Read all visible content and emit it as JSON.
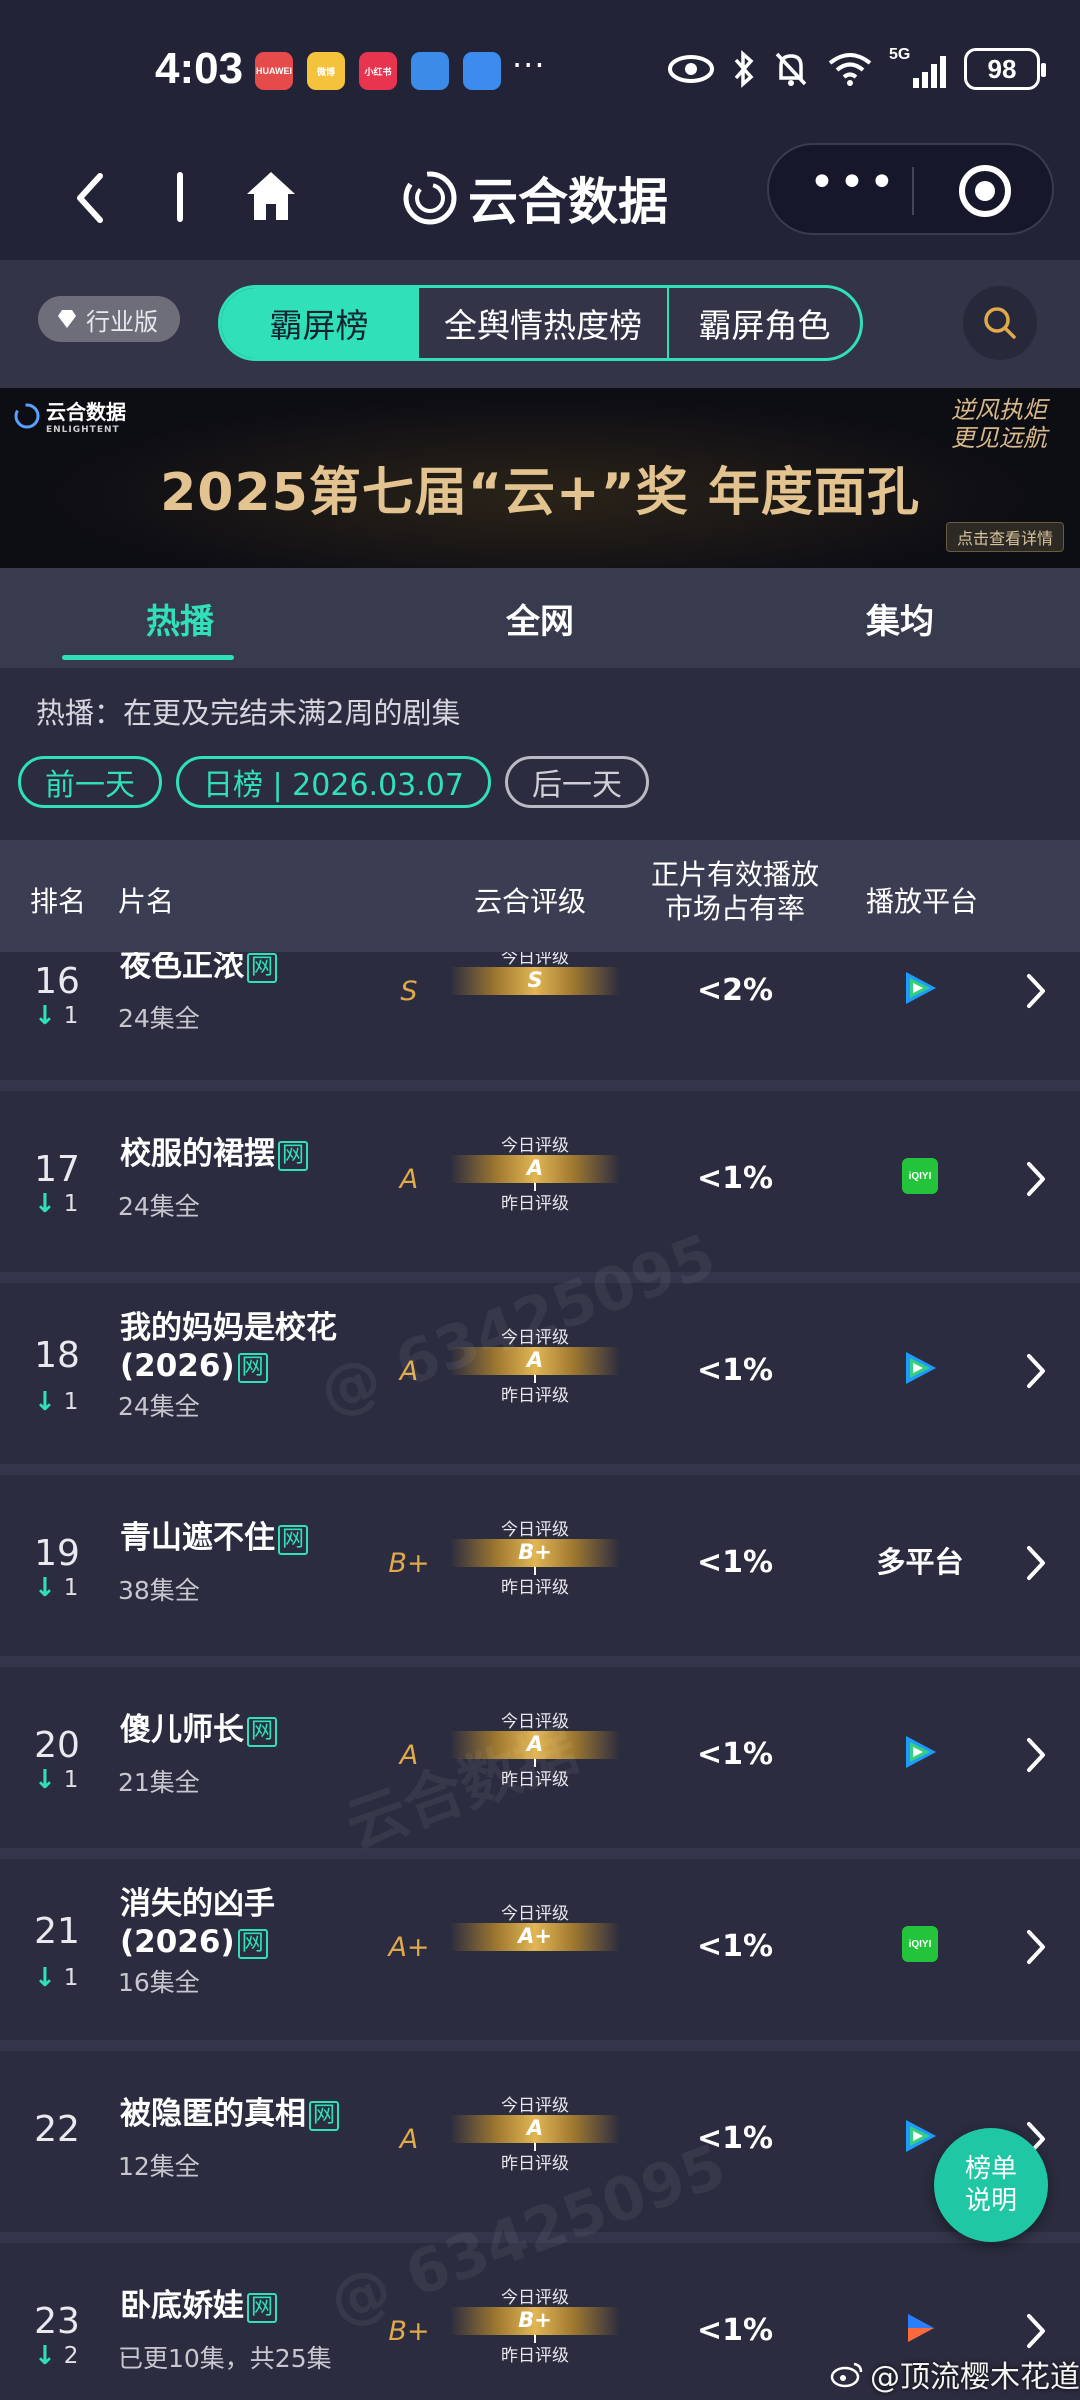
{
  "status": {
    "time": "4:03",
    "battery": "98",
    "network": "5G",
    "more": "···"
  },
  "status_apps": [
    {
      "label": "HUAWEI",
      "color": "#e64b4b"
    },
    {
      "label": "微博",
      "color": "#f5c33b"
    },
    {
      "label": "小红书",
      "color": "#e8344e"
    },
    {
      "label": "",
      "color": "#3b8be8"
    },
    {
      "label": "",
      "color": "#3c8cf0"
    }
  ],
  "header": {
    "brand": "云合数据"
  },
  "filters": {
    "industry_label": "行业版",
    "segments": [
      "霸屏榜",
      "全舆情热度榜",
      "霸屏角色"
    ]
  },
  "banner": {
    "logo_cn": "云合数据",
    "logo_en": "ENLIGHTENT",
    "title": "2025第七届“云+”奖  年度面孔",
    "slogan": "逆风执炬 更见远航",
    "detail": "点击查看详情"
  },
  "tabs": [
    "热播",
    "全网",
    "集均"
  ],
  "description": "热播：在更及完结未满2周的剧集",
  "date_nav": {
    "prev": "前一天",
    "current": "日榜 | 2026.03.07",
    "next": "后一天"
  },
  "table_header": {
    "rank": "排名",
    "name": "片名",
    "grade": "云合评级",
    "share_line1": "正片有效播放",
    "share_line2": "市场占有率",
    "platform": "播放平台"
  },
  "labels": {
    "today_grade": "今日评级",
    "yesterday_grade": "昨日评级",
    "wang_tag": "网"
  },
  "rows": [
    {
      "rank": "16",
      "change": "1",
      "dir": "down",
      "title": "夜色正浓",
      "episodes": "24集全",
      "grade": "S",
      "today": "S",
      "share": "<2%",
      "platform": "tencent",
      "show_yesterday": false
    },
    {
      "rank": "17",
      "change": "1",
      "dir": "down",
      "title": "校服的裙摆",
      "episodes": "24集全",
      "grade": "A",
      "today": "A",
      "share": "<1%",
      "platform": "iqiyi",
      "show_yesterday": true
    },
    {
      "rank": "18",
      "change": "1",
      "dir": "down",
      "title": "我的妈妈是校花(2026)",
      "episodes": "24集全",
      "grade": "A",
      "today": "A",
      "share": "<1%",
      "platform": "tencent",
      "show_yesterday": true
    },
    {
      "rank": "19",
      "change": "1",
      "dir": "down",
      "title": "青山遮不住",
      "episodes": "38集全",
      "grade": "B+",
      "today": "B+",
      "share": "<1%",
      "platform": "多平台",
      "show_yesterday": true
    },
    {
      "rank": "20",
      "change": "1",
      "dir": "down",
      "title": "傻儿师长",
      "episodes": "21集全",
      "grade": "A",
      "today": "A",
      "share": "<1%",
      "platform": "tencent",
      "show_yesterday": true
    },
    {
      "rank": "21",
      "change": "1",
      "dir": "down",
      "title": "消失的凶手(2026)",
      "episodes": "16集全",
      "grade": "A+",
      "today": "A+",
      "share": "<1%",
      "platform": "iqiyi",
      "show_yesterday": false
    },
    {
      "rank": "22",
      "change": "",
      "dir": "",
      "title": "被隐匿的真相",
      "episodes": "12集全",
      "grade": "A",
      "today": "A",
      "share": "<1%",
      "platform": "tencent",
      "show_yesterday": true
    },
    {
      "rank": "23",
      "change": "2",
      "dir": "down",
      "title": "卧底娇娃",
      "episodes": "已更10集，共25集",
      "grade": "B+",
      "today": "B+",
      "share": "<1%",
      "platform": "youku",
      "show_yesterday": true
    }
  ],
  "fab": {
    "line1": "榜单",
    "line2": "说明"
  },
  "weibo_credit": "@顶流樱木花道",
  "watermarks": [
    "@ 63425095",
    "云合数据",
    "ENLIGHTENT"
  ],
  "colors": {
    "accent": "#2fe0b9",
    "gold": "#e0a94b",
    "bg": "#2b2c3f"
  }
}
